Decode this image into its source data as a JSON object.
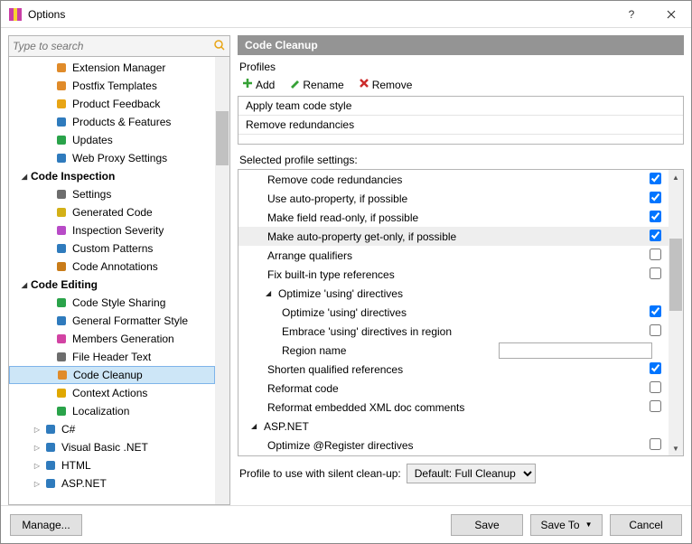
{
  "window": {
    "title": "Options"
  },
  "search": {
    "placeholder": "Type to search"
  },
  "tree": {
    "sections": [
      {
        "type": "item",
        "label": "Extension Manager",
        "level": 1,
        "icon": "puzzle",
        "color": "#e08b2a"
      },
      {
        "type": "item",
        "label": "Postfix Templates",
        "level": 1,
        "icon": "tmpl",
        "color": "#e08b2a"
      },
      {
        "type": "item",
        "label": "Product Feedback",
        "level": 1,
        "icon": "mail",
        "color": "#e8a515"
      },
      {
        "type": "item",
        "label": "Products & Features",
        "level": 1,
        "icon": "box",
        "color": "#2f7bbd"
      },
      {
        "type": "item",
        "label": "Updates",
        "level": 1,
        "icon": "globe",
        "color": "#2aa34a"
      },
      {
        "type": "item",
        "label": "Web Proxy Settings",
        "level": 1,
        "icon": "globe2",
        "color": "#2f7bbd"
      },
      {
        "type": "header",
        "label": "Code Inspection"
      },
      {
        "type": "item",
        "label": "Settings",
        "level": 1,
        "icon": "gear",
        "color": "#6d6d6d"
      },
      {
        "type": "item",
        "label": "Generated Code",
        "level": 1,
        "icon": "gen",
        "color": "#d3b017"
      },
      {
        "type": "item",
        "label": "Inspection Severity",
        "level": 1,
        "icon": "sev",
        "color": "#b84bc7"
      },
      {
        "type": "item",
        "label": "Custom Patterns",
        "level": 1,
        "icon": "grid",
        "color": "#2f7bbd"
      },
      {
        "type": "item",
        "label": "Code Annotations",
        "level": 1,
        "icon": "ann",
        "color": "#c97c19"
      },
      {
        "type": "header",
        "label": "Code Editing"
      },
      {
        "type": "item",
        "label": "Code Style Sharing",
        "level": 1,
        "icon": "share",
        "color": "#2aa34a"
      },
      {
        "type": "item",
        "label": "General Formatter Style",
        "level": 1,
        "icon": "fmt",
        "color": "#2f7bbd"
      },
      {
        "type": "item",
        "label": "Members Generation",
        "level": 1,
        "icon": "mem",
        "color": "#d243a3"
      },
      {
        "type": "item",
        "label": "File Header Text",
        "level": 1,
        "icon": "file",
        "color": "#6d6d6d"
      },
      {
        "type": "item",
        "label": "Code Cleanup",
        "level": 1,
        "icon": "broom",
        "color": "#e08b2a",
        "selected": true
      },
      {
        "type": "item",
        "label": "Context Actions",
        "level": 1,
        "icon": "bulb",
        "color": "#e0a800"
      },
      {
        "type": "item",
        "label": "Localization",
        "level": 1,
        "icon": "loc",
        "color": "#2aa34a"
      },
      {
        "type": "item",
        "label": "C#",
        "level": 1,
        "icon": "cs",
        "color": "#2f7bbd",
        "expandable": true
      },
      {
        "type": "item",
        "label": "Visual Basic .NET",
        "level": 1,
        "icon": "vb",
        "color": "#2f7bbd",
        "expandable": true
      },
      {
        "type": "item",
        "label": "HTML",
        "level": 1,
        "icon": "html",
        "color": "#2f7bbd",
        "expandable": true
      },
      {
        "type": "item",
        "label": "ASP.NET",
        "level": 1,
        "icon": "asp",
        "color": "#2f7bbd",
        "expandable": true
      }
    ]
  },
  "panel": {
    "header": "Code Cleanup",
    "profiles_label": "Profiles",
    "toolbar": {
      "add": "Add",
      "rename": "Rename",
      "remove": "Remove"
    },
    "profiles": [
      "Apply team code style",
      "Remove redundancies"
    ],
    "settings_label": "Selected profile settings:",
    "rows": [
      {
        "label": "Remove code redundancies",
        "indent": 1,
        "check": true
      },
      {
        "label": "Use auto-property, if possible",
        "indent": 1,
        "check": true
      },
      {
        "label": "Make field read-only, if possible",
        "indent": 1,
        "check": true
      },
      {
        "label": "Make auto-property get-only, if possible",
        "indent": 1,
        "check": true,
        "hl": true
      },
      {
        "label": "Arrange qualifiers",
        "indent": 1,
        "check": false
      },
      {
        "label": "Fix built-in type references",
        "indent": 1,
        "check": false
      },
      {
        "label": "Optimize 'using' directives",
        "indent": 0,
        "group": true
      },
      {
        "label": "Optimize 'using' directives",
        "indent": 2,
        "check": true
      },
      {
        "label": "Embrace 'using' directives in region",
        "indent": 2,
        "check": false
      },
      {
        "label": "Region name",
        "indent": 2,
        "text": ""
      },
      {
        "label": "Shorten qualified references",
        "indent": 1,
        "check": true
      },
      {
        "label": "Reformat code",
        "indent": 1,
        "check": false
      },
      {
        "label": "Reformat embedded XML doc comments",
        "indent": 1,
        "check": false
      },
      {
        "label": "ASP.NET",
        "indent": 0,
        "group": true,
        "top": true
      },
      {
        "label": "Optimize @Register directives",
        "indent": 1,
        "check": false
      }
    ],
    "silent_label": "Profile to use with silent clean-up:",
    "silent_value": "Default: Full Cleanup"
  },
  "footer": {
    "manage": "Manage...",
    "save": "Save",
    "saveto": "Save To",
    "cancel": "Cancel"
  }
}
